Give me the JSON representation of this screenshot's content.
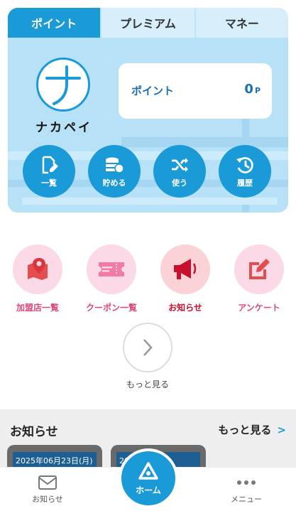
{
  "tabs": [
    {
      "label": "ポイント",
      "active": true
    },
    {
      "label": "プレミアム",
      "active": false
    },
    {
      "label": "マネー",
      "active": false
    }
  ],
  "brand": {
    "logo_char": "ナ",
    "name": "ナカペイ",
    "color": "#1a9ad6"
  },
  "point_box": {
    "label": "ポイント",
    "value": "0",
    "unit": "P"
  },
  "actions": [
    {
      "label": "一覧",
      "icon": "document-edit-icon"
    },
    {
      "label": "貯める",
      "icon": "coin-stack-icon"
    },
    {
      "label": "使う",
      "icon": "shuffle-icon"
    },
    {
      "label": "履歴",
      "icon": "history-icon"
    }
  ],
  "menu": [
    {
      "label": "加盟店一覧",
      "icon": "map-pin-icon",
      "color": "#e0457b",
      "bg": "#fbd9e6"
    },
    {
      "label": "クーポン一覧",
      "icon": "ticket-icon",
      "color": "#e0457b",
      "bg": "#fbd9e6"
    },
    {
      "label": "お知らせ",
      "icon": "megaphone-icon",
      "color": "#c8102e",
      "bg": "#fbd3d6"
    },
    {
      "label": "アンケート",
      "icon": "edit-square-icon",
      "color": "#e0457b",
      "bg": "#fbd9e6"
    }
  ],
  "more": {
    "label": "もっと見る"
  },
  "news": {
    "title": "お知らせ",
    "more_label": "もっと見る",
    "items": [
      {
        "date": "2025年06月23日(月)"
      },
      {
        "date": "202...1日(土)"
      }
    ]
  },
  "bottom_nav": {
    "left": {
      "label": "お知らせ",
      "icon": "mail-icon"
    },
    "center": {
      "label": "ホーム",
      "icon": "home-icon"
    },
    "right": {
      "label": "メニュー",
      "icon": "more-dots-icon"
    }
  }
}
